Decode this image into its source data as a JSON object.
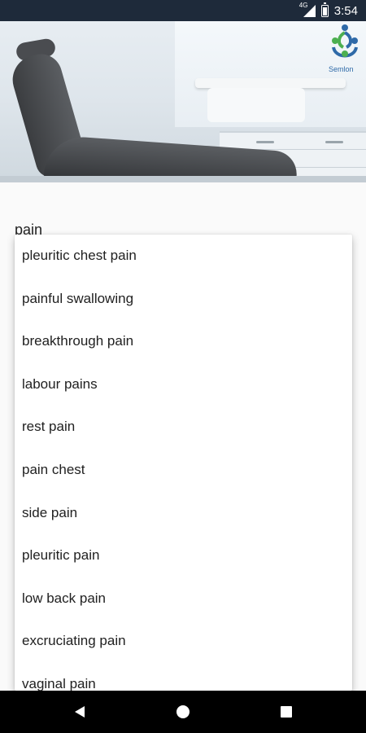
{
  "status_bar": {
    "network": "4G",
    "time": "3:54"
  },
  "header": {
    "logo_text": "Semlon"
  },
  "search": {
    "value": "pain"
  },
  "suggestions": [
    "pleuritic chest pain",
    "painful swallowing",
    "breakthrough pain",
    "labour pains",
    "rest pain",
    "pain chest",
    "side pain",
    "pleuritic pain",
    "low back pain",
    "excruciating pain",
    "vaginal pain"
  ],
  "colors": {
    "status_bar": "#1e2a3a",
    "nav_bar": "#000000",
    "logo_blue": "#2f6aa8",
    "logo_green": "#4caf50"
  },
  "icons": {
    "back": "triangle-back-icon",
    "home": "circle-home-icon",
    "recents": "square-recents-icon"
  }
}
